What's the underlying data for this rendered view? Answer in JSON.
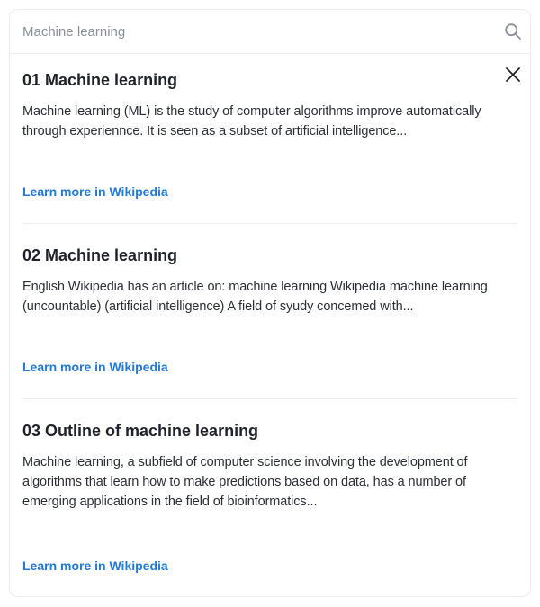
{
  "search": {
    "value": "Machine learning",
    "placeholder": "Machine learning"
  },
  "icons": {
    "search": "search-icon",
    "close": "close-icon"
  },
  "colors": {
    "link": "#2279d6",
    "title": "#1f2329",
    "muted": "#8a9099"
  },
  "results": [
    {
      "title": "01 Machine learning",
      "snippet": "Machine learning (ML) is the study of computer algorithms improve automatically through experiennce. It is seen as a subset of artificial intelligence...",
      "link": "Learn more in Wikipedia"
    },
    {
      "title": "02 Machine learning",
      "snippet": "English Wikipedia has an article on: machine learning Wikipedia machine learning (uncountable) (artificial intelligence) A field of syudy concemed with...",
      "link": "Learn more in Wikipedia"
    },
    {
      "title": "03 Outline of machine learning",
      "snippet": "Machine learning, a subfield of computer science involving the development of algorithms that learn how to make predictions based on data, has a number of emerging applications in the field of bioinformatics...",
      "link": "Learn more in Wikipedia"
    }
  ]
}
